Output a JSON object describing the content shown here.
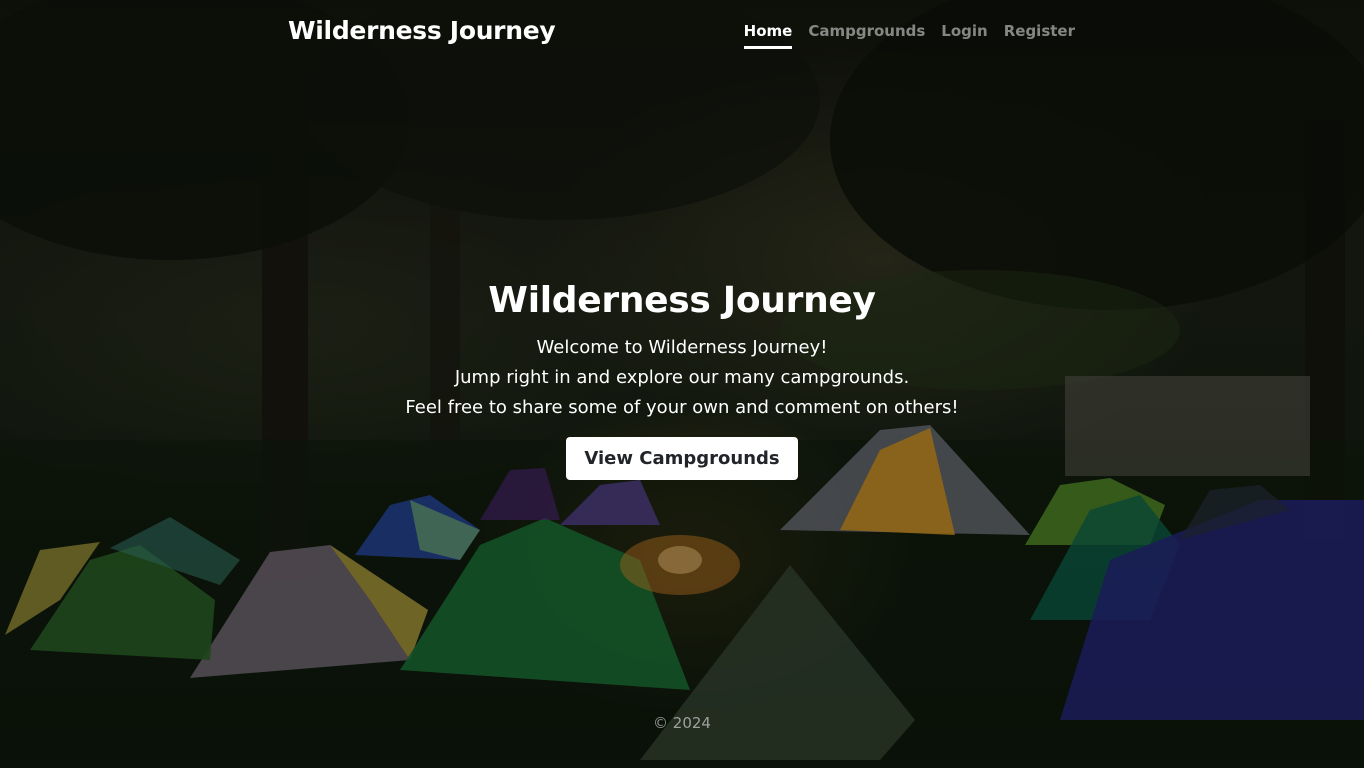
{
  "brand": "Wilderness Journey",
  "nav": {
    "home": "Home",
    "campgrounds": "Campgrounds",
    "login": "Login",
    "register": "Register"
  },
  "hero": {
    "title": "Wilderness Journey",
    "line1": "Welcome to Wilderness Journey!",
    "line2": "Jump right in and explore our many campgrounds.",
    "line3": "Feel free to share some of your own and comment on others!",
    "cta": "View Campgrounds"
  },
  "footer": {
    "copyright": "© 2024"
  },
  "background": {
    "image": "night-campsite-tents-photo"
  }
}
